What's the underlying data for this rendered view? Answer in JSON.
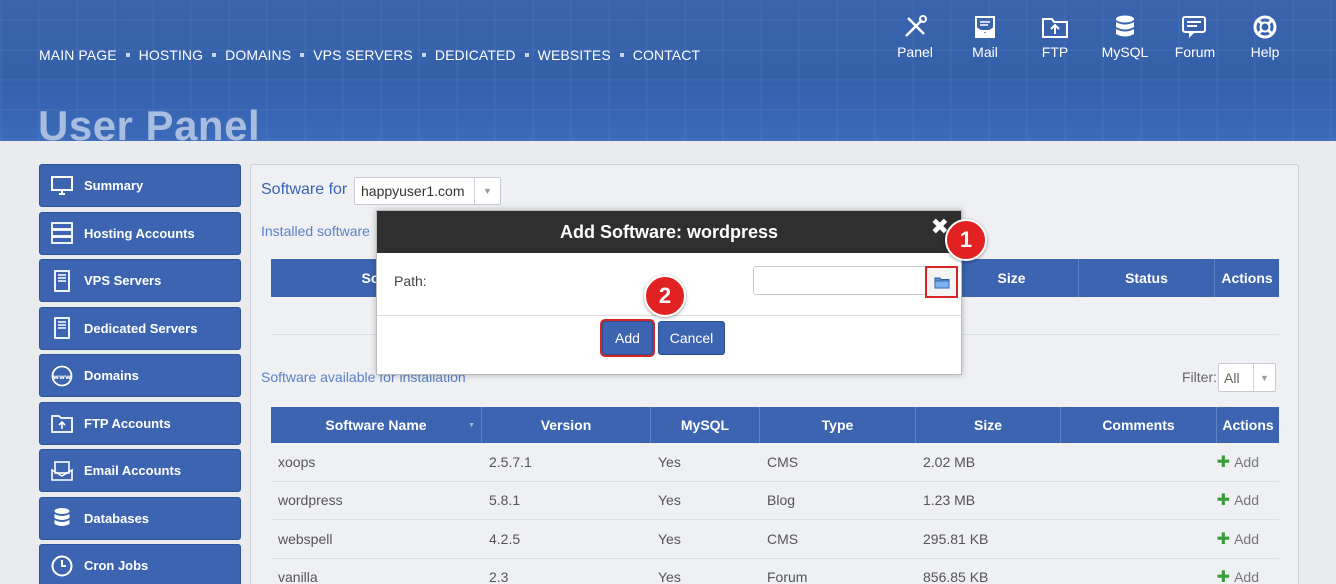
{
  "nav": [
    "MAIN PAGE",
    "HOSTING",
    "DOMAINS",
    "VPS SERVERS",
    "DEDICATED",
    "WEBSITES",
    "CONTACT"
  ],
  "page_title": "User Panel",
  "tools": [
    {
      "label": "Panel",
      "icon": "wrench-screwdriver-icon"
    },
    {
      "label": "Mail",
      "icon": "mail-icon"
    },
    {
      "label": "FTP",
      "icon": "folder-icon"
    },
    {
      "label": "MySQL",
      "icon": "database-icon"
    },
    {
      "label": "Forum",
      "icon": "chat-icon"
    },
    {
      "label": "Help",
      "icon": "lifebuoy-icon"
    }
  ],
  "sidebar": [
    {
      "label": "Summary",
      "icon": "monitor-icon"
    },
    {
      "label": "Hosting Accounts",
      "icon": "server-icon"
    },
    {
      "label": "VPS Servers",
      "icon": "server-tower-icon"
    },
    {
      "label": "Dedicated Servers",
      "icon": "server-tower-icon"
    },
    {
      "label": "Domains",
      "icon": "globe-www-icon"
    },
    {
      "label": "FTP Accounts",
      "icon": "folder-upload-icon"
    },
    {
      "label": "Email Accounts",
      "icon": "mail-open-icon"
    },
    {
      "label": "Databases",
      "icon": "database-icon"
    },
    {
      "label": "Cron Jobs",
      "icon": "clock-icon"
    }
  ],
  "main": {
    "software_for_label": "Software for",
    "domain_value": "happyuser1.com",
    "installed_label": "Installed software",
    "installed_headers": [
      "Software Name",
      "Size",
      "Status",
      "Actions"
    ],
    "installed_partial_header": "So",
    "available_label": "Software available for installation",
    "filter_label": "Filter:",
    "filter_value": "All",
    "available_headers": [
      "Software Name",
      "Version",
      "MySQL",
      "Type",
      "Size",
      "Comments",
      "Actions"
    ],
    "available_rows": [
      {
        "name": "xoops",
        "version": "2.5.7.1",
        "mysql": "Yes",
        "type": "CMS",
        "size": "2.02 MB",
        "action": "Add"
      },
      {
        "name": "wordpress",
        "version": "5.8.1",
        "mysql": "Yes",
        "type": "Blog",
        "size": "1.23 MB",
        "action": "Add"
      },
      {
        "name": "webspell",
        "version": "4.2.5",
        "mysql": "Yes",
        "type": "CMS",
        "size": "295.81 KB",
        "action": "Add"
      },
      {
        "name": "vanilla",
        "version": "2.3",
        "mysql": "Yes",
        "type": "Forum",
        "size": "856.85 KB",
        "action": "Add"
      }
    ]
  },
  "modal": {
    "title": "Add Software: wordpress",
    "close_glyph": "✖",
    "path_label": "Path:",
    "path_value": "",
    "add_label": "Add",
    "cancel_label": "Cancel"
  },
  "badges": [
    "1",
    "2"
  ],
  "colors": {
    "accent": "#3d64b0",
    "highlight": "#d62525",
    "modal_header": "#2f2f2f"
  }
}
